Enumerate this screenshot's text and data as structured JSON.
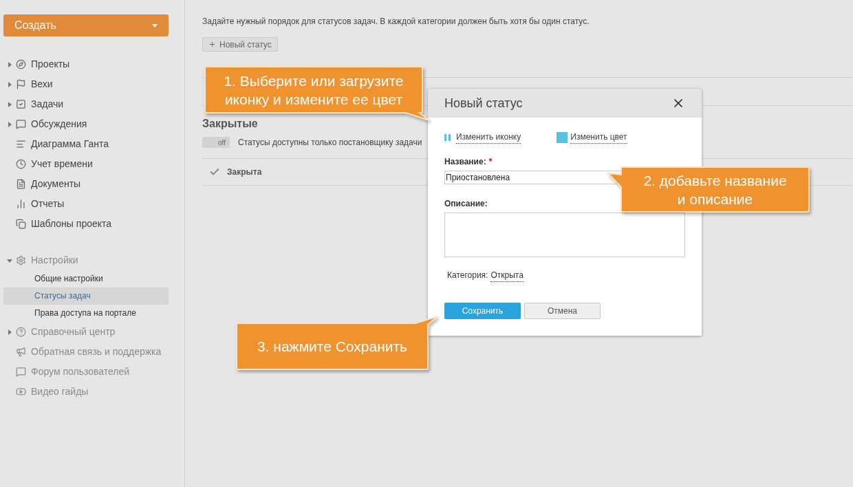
{
  "sidebar": {
    "create_button": {
      "label": "Создать"
    },
    "items": [
      {
        "label": "Проекты",
        "expanded": false,
        "muted": false
      },
      {
        "label": "Вехи",
        "expanded": false,
        "muted": false
      },
      {
        "label": "Задачи",
        "expanded": false,
        "muted": false
      },
      {
        "label": "Обсуждения",
        "expanded": false,
        "muted": false
      },
      {
        "label": "Диаграмма Ганта",
        "muted": false
      },
      {
        "label": "Учет времени",
        "muted": false
      },
      {
        "label": "Документы",
        "muted": false
      },
      {
        "label": "Отчеты",
        "muted": false
      },
      {
        "label": "Шаблоны проекта",
        "muted": false
      },
      {
        "label": "Настройки",
        "expanded": true,
        "muted": true,
        "children": [
          {
            "label": "Общие настройки",
            "selected": false
          },
          {
            "label": "Статусы задач",
            "selected": true
          },
          {
            "label": "Права доступа на портале",
            "selected": false
          }
        ]
      },
      {
        "label": "Справочный центр",
        "expanded": false,
        "muted": true
      },
      {
        "label": "Обратная связь и поддержка",
        "muted": true
      },
      {
        "label": "Форум пользователей",
        "muted": true
      },
      {
        "label": "Видео гайды",
        "muted": true
      }
    ]
  },
  "main": {
    "intro": "Задайте нужный порядок для статусов задач. В каждой категории должен быть хотя бы один статус.",
    "new_status_button": "Новый статус",
    "sections": [
      {
        "kind": "hidden"
      },
      {
        "kind": "full",
        "title": "Закрытые",
        "toggle": {
          "label": "off",
          "on": false,
          "text": "Статусы доступны только постановщику задачи"
        },
        "rows": [
          {
            "label": "Закрыта"
          }
        ]
      }
    ]
  },
  "dialog": {
    "title": "Новый статус",
    "change_icon": "Изменить иконку",
    "change_color": "Изменить цвет",
    "color": "#5bc0de",
    "name_label": "Название:",
    "required_mark": "*",
    "name_value": "Приостановлена",
    "description_label": "Описание:",
    "category_label": "Категория:",
    "category_value": "Открыта",
    "buttons": [
      {
        "label": "Сохранить",
        "kind": "primary"
      },
      {
        "label": "Отмена",
        "kind": "secondary"
      }
    ]
  },
  "callouts": [
    {
      "text": "1. Выберите или загрузите иконку и измените ее цвет"
    },
    {
      "text": "2. добавьте название и описание"
    },
    {
      "text": "3. нажмите Сохранить"
    }
  ]
}
